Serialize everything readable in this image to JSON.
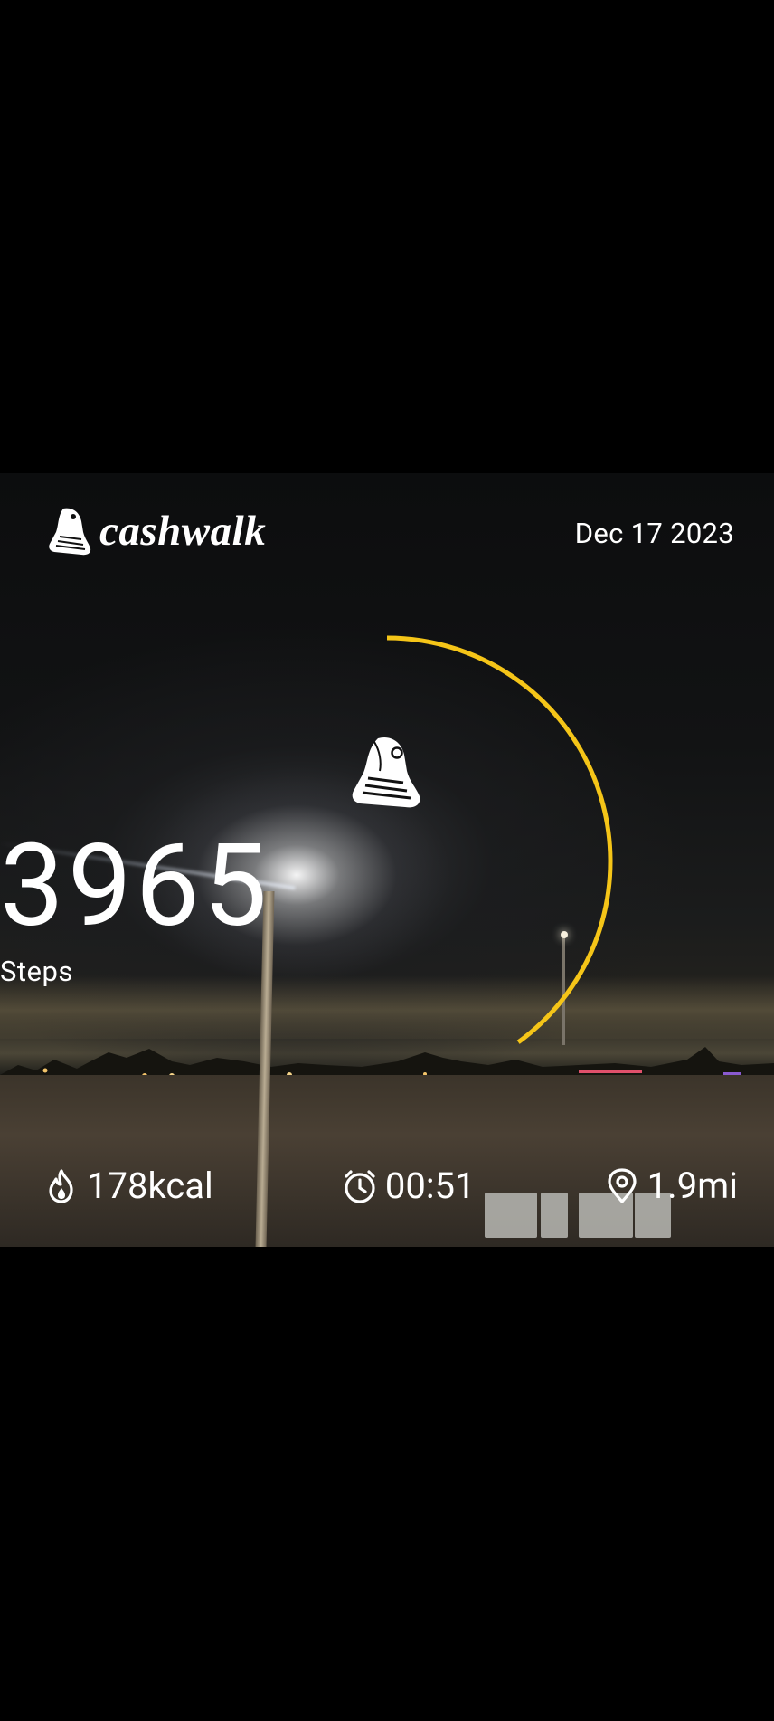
{
  "brand": {
    "name": "cashwalk",
    "logo_icon": "shoe-icon"
  },
  "date": "Dec 17 2023",
  "steps": {
    "value": "3965",
    "label": "Steps",
    "progress": 0.4,
    "ring_color": "#F5C518"
  },
  "stats": [
    {
      "icon": "flame-icon",
      "value": "178kcal"
    },
    {
      "icon": "clock-icon",
      "value": "00:51"
    },
    {
      "icon": "location-pin-icon",
      "value": "1.9mi"
    }
  ]
}
